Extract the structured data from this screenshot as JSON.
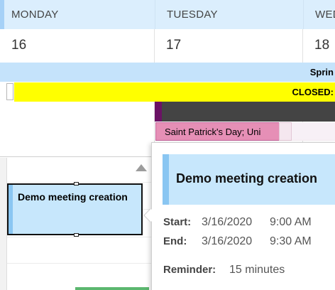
{
  "days": [
    {
      "name": "MONDAY",
      "date": "16"
    },
    {
      "name": "TUESDAY",
      "date": "17"
    },
    {
      "name": "WED",
      "date": "18"
    }
  ],
  "all_day_events": {
    "spring_label": "Sprin",
    "closed_label": "CLOSED:",
    "holiday_label": "Saint Patrick's Day; Uni"
  },
  "event": {
    "title": "Demo meeting creation"
  },
  "peek": {
    "title": "Demo meeting creation",
    "start_label": "Start:",
    "start_date": "3/16/2020",
    "start_time": "9:00 AM",
    "end_label": "End:",
    "end_date": "3/16/2020",
    "end_time": "9:30 AM",
    "reminder_label": "Reminder:",
    "reminder_value": "15 minutes"
  },
  "colors": {
    "header_bg": "#dbeefd",
    "spring_band": "#c5e3fb",
    "closed_band": "#ffff00",
    "holiday_event": "#e68fb6",
    "event_bg": "#c7e7fc",
    "event_accent": "#8ac6f2",
    "dark_event": "#444444"
  }
}
